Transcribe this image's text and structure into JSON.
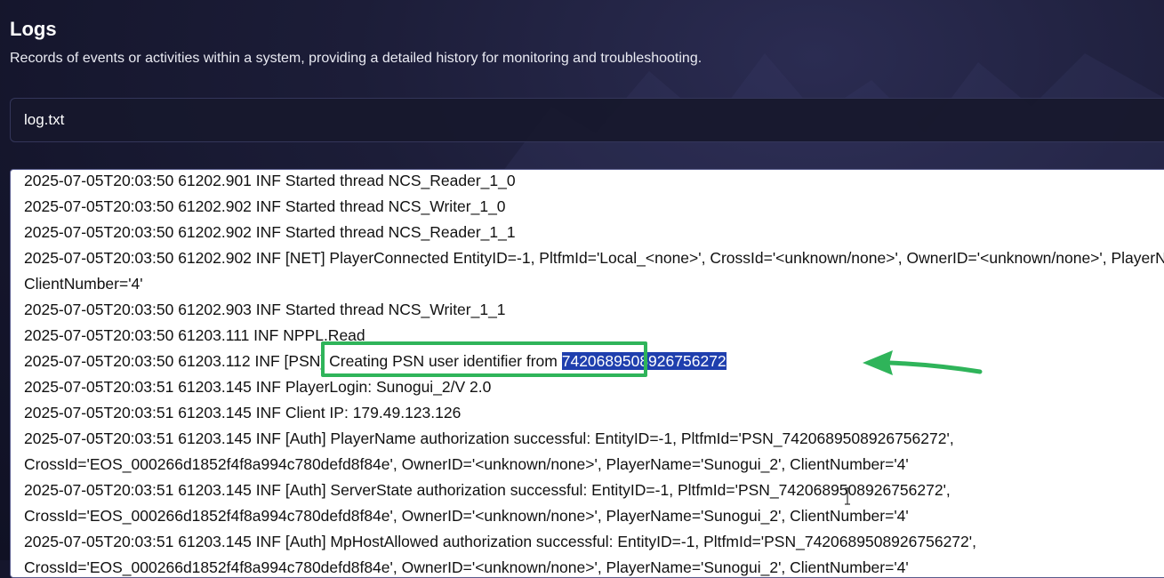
{
  "header": {
    "title": "Logs",
    "subtitle": "Records of events or activities within a system, providing a detailed history for monitoring and troubleshooting."
  },
  "file_select": {
    "value": "log.txt"
  },
  "log": {
    "lines": [
      "2025-07-05T20:03:50 61202.901 INF Started thread NCS_Reader_1_0",
      "2025-07-05T20:03:50 61202.902 INF Started thread NCS_Writer_1_0",
      "2025-07-05T20:03:50 61202.902 INF Started thread NCS_Reader_1_1",
      "2025-07-05T20:03:50 61202.902 INF [NET] PlayerConnected EntityID=-1, PltfmId='Local_<none>', CrossId='<unknown/none>', OwnerID='<unknown/none>', PlayerName='',",
      "ClientNumber='4'",
      "2025-07-05T20:03:50 61202.903 INF Started thread NCS_Writer_1_1",
      "2025-07-05T20:03:50 61203.111 INF NPPL.Read",
      "2025-07-05T20:03:51 61203.145 INF PlayerLogin: Sunogui_2/V 2.0",
      "2025-07-05T20:03:51 61203.145 INF Client IP: 179.49.123.126",
      "2025-07-05T20:03:51 61203.145 INF [Auth] PlayerName authorization successful: EntityID=-1, PltfmId='PSN_7420689508926756272',",
      "CrossId='EOS_000266d1852f4f8a994c780defd8f84e', OwnerID='<unknown/none>', PlayerName='Sunogui_2', ClientNumber='4'",
      "2025-07-05T20:03:51 61203.145 INF [Auth] ServerState authorization successful: EntityID=-1, PltfmId='PSN_7420689508926756272',",
      "CrossId='EOS_000266d1852f4f8a994c780defd8f84e', OwnerID='<unknown/none>', PlayerName='Sunogui_2', ClientNumber='4'",
      "2025-07-05T20:03:51 61203.145 INF [Auth] MpHostAllowed authorization successful: EntityID=-1, PltfmId='PSN_7420689508926756272',",
      "CrossId='EOS_000266d1852f4f8a994c780defd8f84e', OwnerID='<unknown/none>', PlayerName='Sunogui_2', ClientNumber='4'"
    ],
    "psn_line": {
      "prefix": "2025-07-05T20:03:50 61203.112 INF ",
      "boxed": "[PSN] Creating PSN user identifier from ",
      "selected": "7420689508926756272"
    }
  },
  "colors": {
    "highlight_box": "#2fb45a",
    "arrow": "#2fb45a",
    "selection": "#1f3fae"
  }
}
